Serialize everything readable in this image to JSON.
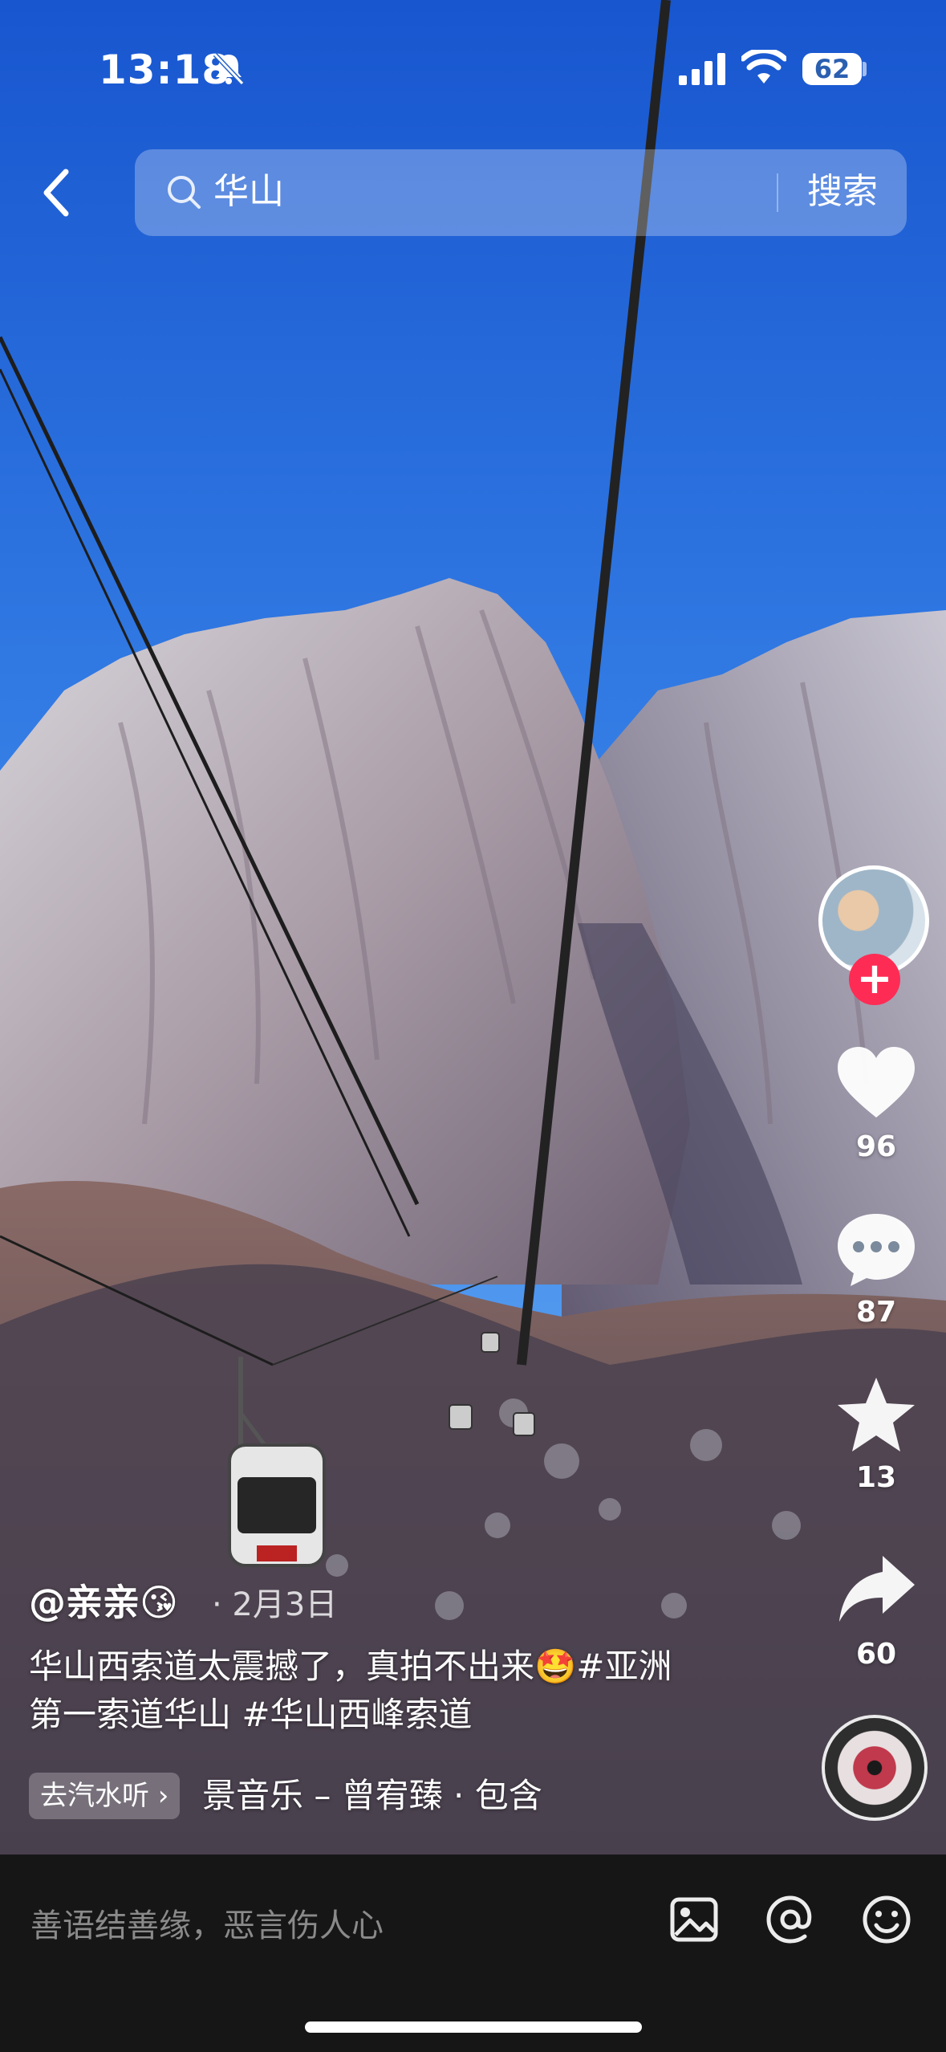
{
  "status_bar": {
    "time": "13:18",
    "battery": "62"
  },
  "search": {
    "query": "华山",
    "button": "搜索"
  },
  "actions": {
    "likes": "96",
    "comments": "87",
    "favorites": "13",
    "shares": "60"
  },
  "post": {
    "author": "@亲亲😘",
    "date": "· 2月3日",
    "caption_line1": "华山西索道太震撼了，真拍不出来🤩#亚洲",
    "caption_line2": "第一索道华山 #华山西峰索道",
    "music_badge": "去汽水听 ›",
    "music_text": "景音乐 – 曾宥臻 · 包含"
  },
  "comment_bar": {
    "placeholder": "善语结善缘，恶言伤人心"
  },
  "icons": {
    "back": "chevron-left-icon",
    "search": "search-icon",
    "bell": "bell-muted-icon",
    "like": "heart-icon",
    "comment": "chat-bubble-icon",
    "favorite": "star-icon",
    "share": "share-arrow-icon",
    "image": "image-icon",
    "mention": "at-icon",
    "emoji": "emoji-icon"
  },
  "colors": {
    "follow": "#fe2c55",
    "sky": "#1f63d6",
    "comment_bar": "#161616"
  }
}
